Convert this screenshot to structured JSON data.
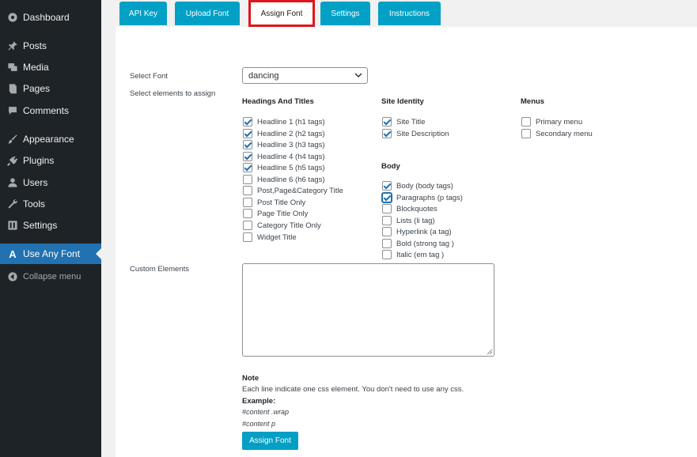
{
  "sidebar": {
    "items": [
      {
        "label": "Dashboard",
        "icon": "dashboard-icon"
      },
      {
        "label": "Posts",
        "icon": "pin-icon"
      },
      {
        "label": "Media",
        "icon": "media-icon"
      },
      {
        "label": "Pages",
        "icon": "pages-icon"
      },
      {
        "label": "Comments",
        "icon": "comment-icon"
      },
      {
        "label": "Appearance",
        "icon": "brush-icon"
      },
      {
        "label": "Plugins",
        "icon": "plug-icon"
      },
      {
        "label": "Users",
        "icon": "user-icon"
      },
      {
        "label": "Tools",
        "icon": "wrench-icon"
      },
      {
        "label": "Settings",
        "icon": "settings-icon"
      },
      {
        "label": "Use Any Font",
        "icon": "A"
      },
      {
        "label": "Collapse menu",
        "icon": "collapse-icon"
      }
    ]
  },
  "tabs": [
    "API Key",
    "Upload Font",
    "Assign Font",
    "Settings",
    "Instructions"
  ],
  "form": {
    "select_font_label": "Select Font",
    "select_font_value": "dancing",
    "select_elements_label": "Select elements to assign",
    "custom_elements_label": "Custom Elements"
  },
  "groups": {
    "headings": {
      "title": "Headings And Titles",
      "items": [
        {
          "label": "Headline 1 (h1 tags)",
          "checked": true
        },
        {
          "label": "Headline 2 (h2 tags)",
          "checked": true
        },
        {
          "label": "Headline 3 (h3 tags)",
          "checked": true
        },
        {
          "label": "Headline 4 (h4 tags)",
          "checked": true
        },
        {
          "label": "Headline 5 (h5 tags)",
          "checked": true
        },
        {
          "label": "Headline 6 (h6 tags)",
          "checked": false
        },
        {
          "label": "Post,Page&Category Title",
          "checked": false
        },
        {
          "label": "Post Title Only",
          "checked": false
        },
        {
          "label": "Page Title Only",
          "checked": false
        },
        {
          "label": "Category Title Only",
          "checked": false
        },
        {
          "label": "Widget Title",
          "checked": false
        }
      ]
    },
    "site_identity": {
      "title": "Site Identity",
      "items": [
        {
          "label": "Site Title",
          "checked": true
        },
        {
          "label": "Site Description",
          "checked": true
        }
      ]
    },
    "body": {
      "title": "Body",
      "items": [
        {
          "label": "Body (body tags)",
          "checked": true
        },
        {
          "label": "Paragraphs (p tags)",
          "checked": true
        },
        {
          "label": "Blockquotes",
          "checked": false
        },
        {
          "label": "Lists (li tag)",
          "checked": false
        },
        {
          "label": "Hyperlink (a tag)",
          "checked": false
        },
        {
          "label": "Bold (strong tag )",
          "checked": false
        },
        {
          "label": "Italic (em tag )",
          "checked": false
        }
      ]
    },
    "menus": {
      "title": "Menus",
      "items": [
        {
          "label": "Primary menu",
          "checked": false
        },
        {
          "label": "Secondary menu",
          "checked": false
        }
      ]
    }
  },
  "note": {
    "title": "Note",
    "text": "Each line indicate one css element. You don't need to use any css.",
    "example_title": "Example:",
    "example_1": "#content .wrap",
    "example_2": "#content p"
  },
  "button_label": "Assign Font",
  "colors": {
    "accent": "#02a0c5",
    "sidebar": "#1d2327",
    "active_menu": "#2271b1",
    "highlight": "#e0151b"
  }
}
